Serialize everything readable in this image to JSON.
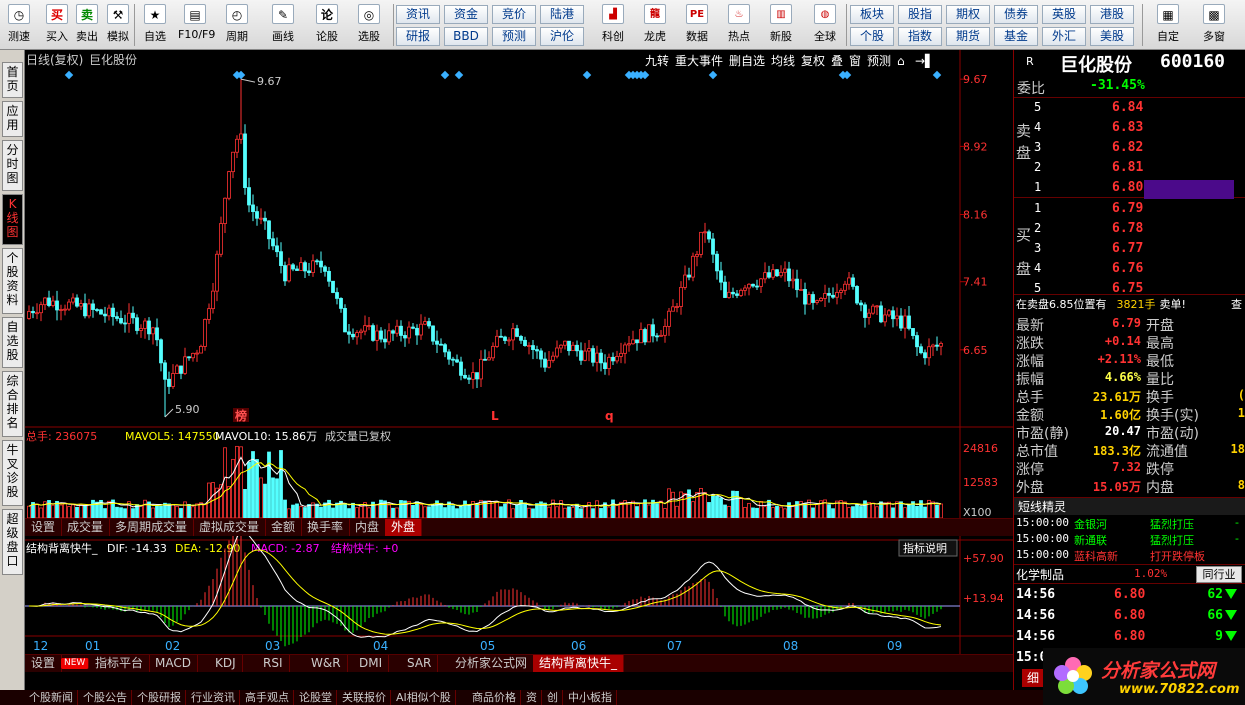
{
  "toolbar": {
    "items": [
      {
        "label": "测速",
        "icon": "clock-icon",
        "glyph": "◷"
      },
      {
        "label": "买入",
        "icon": "buy-icon",
        "glyph": "买"
      },
      {
        "label": "卖出",
        "icon": "sell-icon",
        "glyph": "卖"
      },
      {
        "label": "模拟",
        "icon": "hammer-icon",
        "glyph": "⚒"
      },
      {
        "label": "自选",
        "icon": "star-icon",
        "glyph": "★"
      },
      {
        "label": "F10/F9",
        "icon": "f10-icon",
        "glyph": "▤"
      },
      {
        "label": "周期",
        "icon": "period-icon",
        "glyph": "◴"
      },
      {
        "label": "画线",
        "icon": "pen-icon",
        "glyph": "✎"
      },
      {
        "label": "论股",
        "icon": "discuss-icon",
        "glyph": "论"
      },
      {
        "label": "选股",
        "icon": "select-icon",
        "glyph": "◎"
      }
    ],
    "grid": [
      [
        "资讯",
        "资金",
        "竞价",
        "陆港"
      ],
      [
        "研报",
        "BBD",
        "预测",
        "沪伦"
      ]
    ],
    "mid": [
      {
        "label": "科创",
        "icon": "chart-icon",
        "glyph": "▟"
      },
      {
        "label": "龙虎",
        "icon": "dragon-icon",
        "glyph": "龍"
      },
      {
        "label": "数据",
        "icon": "pe-icon",
        "glyph": "PE"
      },
      {
        "label": "热点",
        "icon": "hot-icon",
        "glyph": "♨"
      },
      {
        "label": "新股",
        "icon": "ipo-icon",
        "glyph": "▥"
      },
      {
        "label": "全球",
        "icon": "globe-icon",
        "glyph": "◍"
      }
    ],
    "grid2": [
      [
        "板块",
        "股指",
        "期权",
        "债券",
        "英股",
        "港股"
      ],
      [
        "个股",
        "指数",
        "期货",
        "基金",
        "外汇",
        "美股"
      ]
    ],
    "right": [
      {
        "label": "自定",
        "icon": "custom-icon",
        "glyph": "▦"
      },
      {
        "label": "多窗",
        "icon": "multiwin-icon",
        "glyph": "▩"
      }
    ]
  },
  "left_tabs": [
    "首页",
    "应用",
    "分时图",
    "K线图",
    "个股资料",
    "自选股",
    "综合排名",
    "牛叉诊股",
    "超级盘口"
  ],
  "chart_header": {
    "title": "日线(复权)",
    "stock": "巨化股份",
    "tools": [
      "九转",
      "重大事件",
      "删自选",
      "均线",
      "复权",
      "叠",
      "窗",
      "预测",
      "⌂",
      "→▌"
    ]
  },
  "chart_data": {
    "type": "candlestick",
    "price_axis": [
      "9.67",
      "8.92",
      "8.16",
      "7.41",
      "6.65"
    ],
    "ylim": [
      5.8,
      9.75
    ],
    "high_label": "9.67",
    "low_label": "5.90",
    "x_ticks": [
      "12",
      "01",
      "02",
      "03",
      "04",
      "05",
      "06",
      "07",
      "08",
      "09"
    ],
    "markers": [
      "榜",
      "L",
      "q"
    ],
    "volume_legend": {
      "total": "总手: 236075",
      "ma5": "MAVOL5: 147550",
      "ma10": "MAVOL10: 15.86万",
      "note": "成交量已复权"
    },
    "volume_axis": [
      "24816",
      "12583",
      "X100"
    ],
    "macd_legend": {
      "name": "结构背离快牛_",
      "dif": "DIF: -14.33",
      "dea": "DEA: -12.90",
      "macd": "MACD: -2.87",
      "signal": "结构快牛: +0"
    },
    "macd_axis": [
      "+57.90",
      "+13.94"
    ],
    "macd_help": "指标说明",
    "colors": {
      "up": "#ff3232",
      "down": "#54ffff",
      "ma5": "#ffffff",
      "ma10": "#ffff00"
    }
  },
  "vol_tabs": [
    "设置",
    "成交量",
    "多周期成交量",
    "虚拟成交量",
    "金额",
    "换手率",
    "内盘",
    "外盘"
  ],
  "ind_tabs": [
    "设置",
    "NEW",
    "指标平台",
    "MACD",
    "KDJ",
    "RSI",
    "W&R",
    "DMI",
    "SAR",
    "分析家公式网",
    "结构背离快牛_"
  ],
  "bottom_tabs": [
    "个股新闻",
    "个股公告",
    "个股研报",
    "行业资讯",
    "高手观点",
    "论股堂",
    "关联报价",
    "AI相似个股",
    "商品价格",
    "资",
    "创",
    "中小板指"
  ],
  "quote": {
    "r_label": "R",
    "name": "巨化股份",
    "code": "600160",
    "weibi_label": "委比",
    "weibi": "-31.45%",
    "sell_label": "卖盘",
    "buy_label": "买盘",
    "asks": [
      [
        "5",
        "6.84"
      ],
      [
        "4",
        "6.83"
      ],
      [
        "3",
        "6.82"
      ],
      [
        "2",
        "6.81"
      ],
      [
        "1",
        "6.80"
      ]
    ],
    "bids": [
      [
        "1",
        "6.79"
      ],
      [
        "2",
        "6.78"
      ],
      [
        "3",
        "6.77"
      ],
      [
        "4",
        "6.76"
      ],
      [
        "5",
        "6.75"
      ]
    ],
    "notice": "在卖盘6.85位置有",
    "notice_vol": "3821手",
    "notice_tail": "卖单!",
    "notice_btn": "查",
    "stats": [
      [
        "最新",
        "6.79",
        "开盘",
        ""
      ],
      [
        "涨跌",
        "+0.14",
        "最高",
        ""
      ],
      [
        "涨幅",
        "+2.11%",
        "最低",
        ""
      ],
      [
        "振幅",
        "4.66%",
        "量比",
        ""
      ],
      [
        "总手",
        "23.61万",
        "换手",
        "("
      ],
      [
        "金额",
        "1.60亿",
        "换手(实)",
        "1"
      ],
      [
        "市盈(静)",
        "20.47",
        "市盈(动)",
        ""
      ],
      [
        "总市值",
        "183.3亿",
        "流通值",
        "18"
      ],
      [
        "涨停",
        "7.32",
        "跌停",
        ""
      ],
      [
        "外盘",
        "15.05万",
        "内盘",
        "8"
      ]
    ],
    "elf_title": "短线精灵",
    "elf": [
      [
        "15:00:00",
        "金银河",
        "猛烈打压",
        "-"
      ],
      [
        "15:00:00",
        "新通联",
        "猛烈打压",
        "-"
      ],
      [
        "15:00:00",
        "蓝科高新",
        "打开跌停板",
        ""
      ]
    ],
    "sector": "化学制品",
    "sector_pct": "1.02%",
    "sector_btn": "同行业",
    "ticks": [
      [
        "14:56",
        "6.80",
        "62"
      ],
      [
        "14:56",
        "6.80",
        "66"
      ],
      [
        "14:56",
        "6.80",
        "9"
      ],
      [
        "15:00",
        "",
        ""
      ]
    ],
    "detail_btn": "细"
  },
  "watermark": {
    "text": "分析家公式网",
    "url": "www.70822.com"
  }
}
